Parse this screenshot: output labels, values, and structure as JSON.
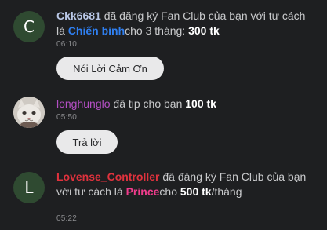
{
  "messages": [
    {
      "avatar_letter": "C",
      "username": "Ckk6681",
      "text_before": " đã đăng ký Fan Club của bạn với tư cách là ",
      "tier": "Chiến binh",
      "text_after": "cho 3 tháng: ",
      "amount": "300 tk",
      "time": "06:10",
      "button_label": "Nói Lời Cảm Ơn"
    },
    {
      "avatar_icon": "cat-avatar-icon",
      "username": "longhunglo",
      "text": " đã tip cho bạn ",
      "amount": "100 tk",
      "time": "05:50",
      "button_label": "Trả lời"
    },
    {
      "avatar_letter": "L",
      "username": "Lovense_Controller",
      "text_before": " đã đăng ký Fan Club của bạn với tư cách là ",
      "tier": "Prince",
      "text_after": "cho ",
      "amount": "500 tk",
      "suffix": "/tháng",
      "time": "05:22"
    }
  ],
  "colors": {
    "background": "#1e1f21",
    "username_1": "#b9c7e6",
    "username_2": "#b44fc4",
    "username_3": "#e0323d",
    "tier_blue": "#2f7ff0",
    "tier_pink": "#f03c8c",
    "button_bg": "#e9e9ea"
  }
}
